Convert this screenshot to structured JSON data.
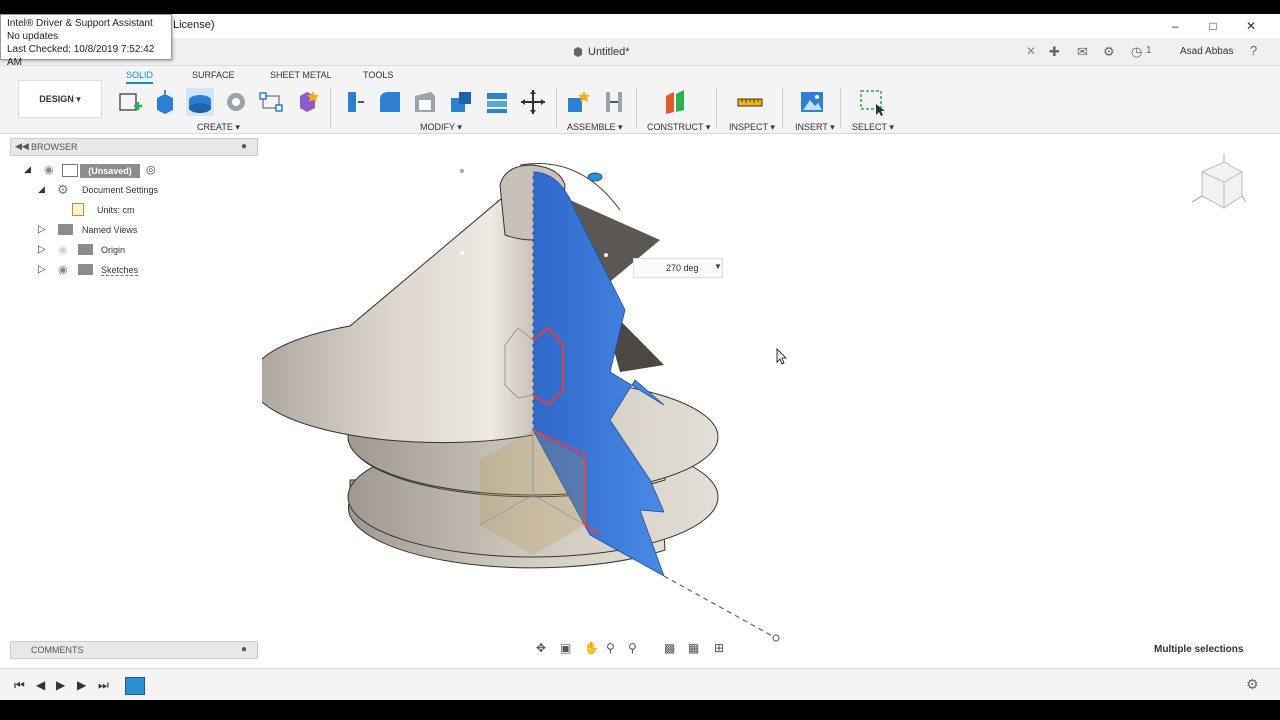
{
  "notification": {
    "title": "Intel® Driver & Support Assistant",
    "line2": "No updates",
    "line3": "Last Checked: 10/8/2019 7:52:42 AM"
  },
  "titlebar": {
    "license": "License)"
  },
  "document": {
    "name": "Untitled*",
    "user": "Asad Abbas",
    "jobs_count": "1"
  },
  "ribbon": {
    "workspace": "DESIGN ▾",
    "tabs": [
      {
        "label": "SOLID",
        "active": true
      },
      {
        "label": "SURFACE"
      },
      {
        "label": "SHEET METAL"
      },
      {
        "label": "TOOLS"
      }
    ],
    "groups": {
      "create": "CREATE ▾",
      "modify": "MODIFY ▾",
      "assemble": "ASSEMBLE ▾",
      "construct": "CONSTRUCT ▾",
      "inspect": "INSPECT ▾",
      "insert": "INSERT ▾",
      "select": "SELECT ▾"
    }
  },
  "browser": {
    "title": "BROWSER",
    "items": [
      {
        "label": "(Unsaved)"
      },
      {
        "label": "Document Settings"
      },
      {
        "label": "Units: cm"
      },
      {
        "label": "Named Views"
      },
      {
        "label": "Origin"
      },
      {
        "label": "Sketches"
      }
    ]
  },
  "comments": {
    "title": "COMMENTS"
  },
  "viewport": {
    "angle_value": "270 deg",
    "status": "Multiple selections"
  },
  "colors": {
    "accent": "#0696d7",
    "face_blue": "#3a78d6",
    "metal": "#c8c2b8"
  }
}
